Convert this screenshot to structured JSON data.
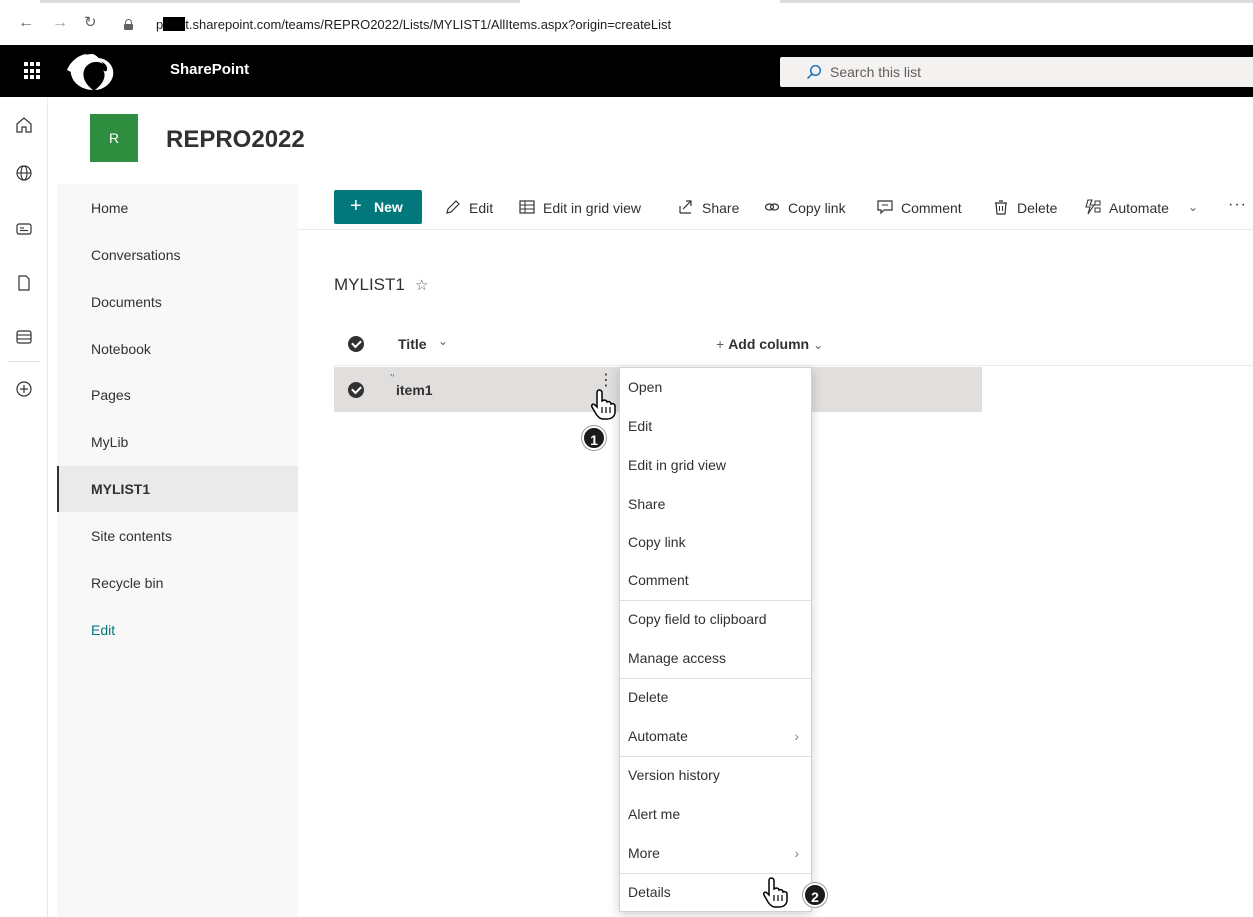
{
  "browser": {
    "back_icon": "arrow-left",
    "forward_icon": "arrow-right",
    "reload_icon": "reload",
    "url_prefix": "p",
    "url_rest": "t.sharepoint.com/teams/REPRO2022/Lists/MYLIST1/AllItems.aspx?origin=createList"
  },
  "suite": {
    "app_name": "SharePoint",
    "search_placeholder": "Search this list"
  },
  "site": {
    "logo_letter": "R",
    "title": "REPRO2022",
    "logo_color": "#2f8d3f"
  },
  "leftnav": {
    "items": [
      {
        "label": "Home"
      },
      {
        "label": "Conversations"
      },
      {
        "label": "Documents"
      },
      {
        "label": "Notebook"
      },
      {
        "label": "Pages"
      },
      {
        "label": "MyLib"
      },
      {
        "label": "MYLIST1",
        "selected": true
      },
      {
        "label": "Site contents"
      },
      {
        "label": "Recycle bin"
      },
      {
        "label": "Edit"
      }
    ]
  },
  "command_bar": {
    "new_label": "New",
    "edit_label": "Edit",
    "grid_label": "Edit in grid view",
    "share_label": "Share",
    "copylink_label": "Copy link",
    "comment_label": "Comment",
    "delete_label": "Delete",
    "automate_label": "Automate",
    "more_label": "···",
    "accent_color": "#03787c"
  },
  "list": {
    "title": "MYLIST1",
    "columns": {
      "title": "Title",
      "add_column": "Add column"
    },
    "rows": [
      {
        "title": "item1"
      }
    ]
  },
  "context_menu": {
    "items": [
      "Open",
      "Edit",
      "Edit in grid view",
      "Share",
      "Copy link",
      "Comment",
      "Copy field to clipboard",
      "Manage access",
      "Delete",
      "Automate",
      "Version history",
      "Alert me",
      "More",
      "Details"
    ]
  },
  "annotations": {
    "step1": "1",
    "step2": "2"
  }
}
